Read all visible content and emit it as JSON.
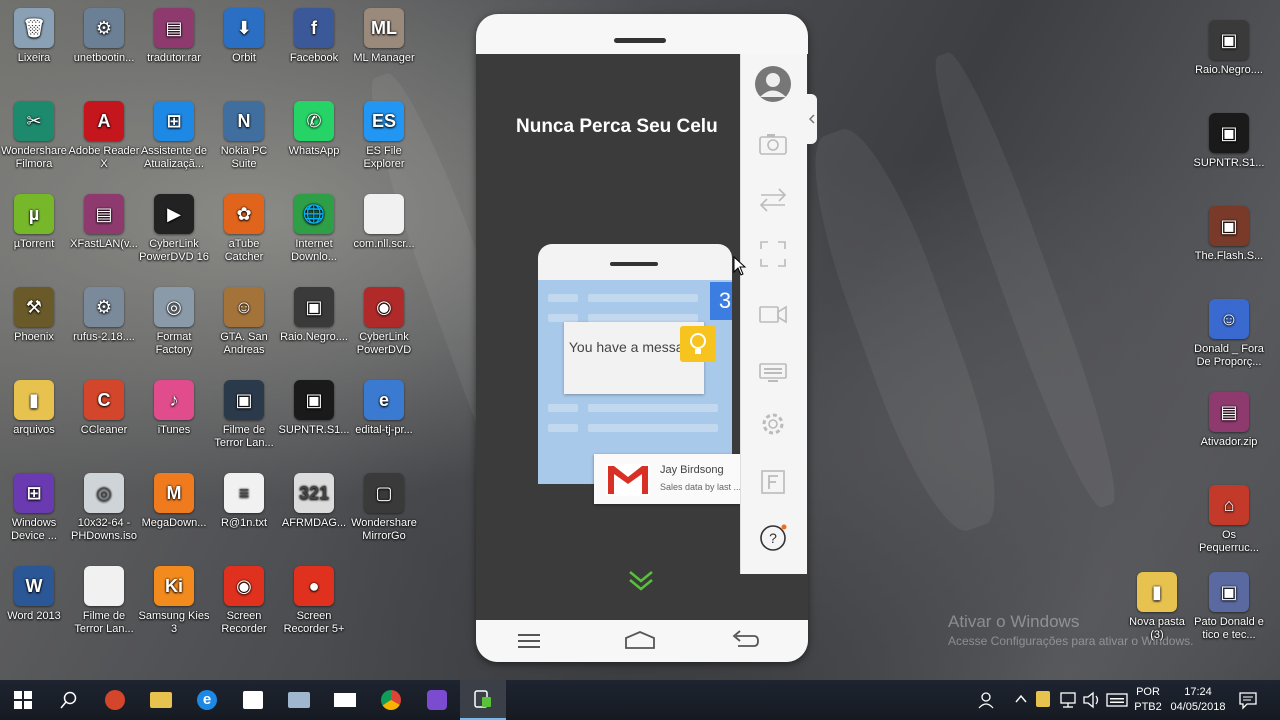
{
  "desktop": {
    "icons_left": [
      {
        "label": "Lixeira",
        "color": "#8aa0b4",
        "glyph": "🗑"
      },
      {
        "label": "unetbootin...",
        "color": "#6b7f95",
        "glyph": "⚙"
      },
      {
        "label": "tradutor.rar",
        "color": "#8e3a6e",
        "glyph": "▤"
      },
      {
        "label": "Orbit",
        "color": "#2a6fc4",
        "glyph": "⬇"
      },
      {
        "label": "Facebook",
        "color": "#3b5998",
        "glyph": "f"
      },
      {
        "label": "ML Manager",
        "color": "#9a8a7c",
        "glyph": "ML"
      },
      {
        "label": "Wondershare Filmora",
        "color": "#1d8a6e",
        "glyph": "✂"
      },
      {
        "label": "Adobe Reader X",
        "color": "#c4161c",
        "glyph": "A"
      },
      {
        "label": "Assistente de Atualizaçã...",
        "color": "#1e88e5",
        "glyph": "⊞"
      },
      {
        "label": "Nokia PC Suite",
        "color": "#3f6e9f",
        "glyph": "N"
      },
      {
        "label": "WhatsApp",
        "color": "#25d366",
        "glyph": "✆"
      },
      {
        "label": "ES File Explorer",
        "color": "#2196f3",
        "glyph": "ES"
      },
      {
        "label": "µTorrent",
        "color": "#76b82a",
        "glyph": "µ"
      },
      {
        "label": "XFastLAN(v...",
        "color": "#8e3a6e",
        "glyph": "▤"
      },
      {
        "label": "CyberLink PowerDVD 16",
        "color": "#222222",
        "glyph": "▶"
      },
      {
        "label": "aTube Catcher",
        "color": "#e0641c",
        "glyph": "✿"
      },
      {
        "label": "Internet Downlo...",
        "color": "#2e9e47",
        "glyph": "🌐"
      },
      {
        "label": "com.nll.scr...",
        "color": "#f1f1f1",
        "glyph": ""
      },
      {
        "label": "Phoenix",
        "color": "#6a5a2a",
        "glyph": "⚒"
      },
      {
        "label": "rufus-2.18....",
        "color": "#7a8a9a",
        "glyph": "⚙"
      },
      {
        "label": "Format Factory",
        "color": "#8b9aa8",
        "glyph": "◎"
      },
      {
        "label": "GTA. San Andreas",
        "color": "#a4733a",
        "glyph": "☺"
      },
      {
        "label": "Raio.Negro....",
        "color": "#3a3a3a",
        "glyph": "▣"
      },
      {
        "label": "CyberLink PowerDVD",
        "color": "#b02a2a",
        "glyph": "◉"
      },
      {
        "label": "arquivos",
        "color": "#e8c24f",
        "glyph": "▮"
      },
      {
        "label": "CCleaner",
        "color": "#d4462b",
        "glyph": "C"
      },
      {
        "label": "iTunes",
        "color": "#e04c8c",
        "glyph": "♪"
      },
      {
        "label": "Filme de Terror Lan...",
        "color": "#2a3a4a",
        "glyph": "▣"
      },
      {
        "label": "SUPNTR.S1...",
        "color": "#1a1a1a",
        "glyph": "▣"
      },
      {
        "label": "edital-tj-pr...",
        "color": "#3a7ad0",
        "glyph": "e"
      },
      {
        "label": "Windows Device ...",
        "color": "#6a3ab0",
        "glyph": "⊞"
      },
      {
        "label": "10x32-64 - PHDowns.iso",
        "color": "#cfd4d8",
        "glyph": "◎"
      },
      {
        "label": "MegaDown...",
        "color": "#f07b1e",
        "glyph": "M"
      },
      {
        "label": "R@1n.txt",
        "color": "#f1f1f1",
        "glyph": "≡"
      },
      {
        "label": "AFRMDAG...",
        "color": "#dcdcdc",
        "glyph": "321"
      },
      {
        "label": "Wondershare MirrorGo",
        "color": "#3a3a3a",
        "glyph": "▢"
      },
      {
        "label": "Word 2013",
        "color": "#2b5797",
        "glyph": "W"
      },
      {
        "label": "Filme de Terror Lan...",
        "color": "#f1f1f1",
        "glyph": ""
      },
      {
        "label": "Samsung Kies 3",
        "color": "#f28a1e",
        "glyph": "Ki"
      },
      {
        "label": "Screen Recorder",
        "color": "#e0311e",
        "glyph": "◉"
      },
      {
        "label": "Screen Recorder 5+",
        "color": "#e0311e",
        "glyph": "●"
      }
    ],
    "icons_right": [
      {
        "label": "Raio.Negro....",
        "color": "#3a3a3a",
        "glyph": "▣"
      },
      {
        "label": "SUPNTR.S1...",
        "color": "#1a1a1a",
        "glyph": "▣"
      },
      {
        "label": "The.Flash.S...",
        "color": "#7a3a2a",
        "glyph": "▣"
      },
      {
        "label": "Donald _ Fora De Proporç...",
        "color": "#3a6ad0",
        "glyph": "☺"
      },
      {
        "label": "Ativador.zip",
        "color": "#8e3a6e",
        "glyph": "▤"
      },
      {
        "label": "Os Pequerruc...",
        "color": "#c43a2a",
        "glyph": "⌂"
      },
      {
        "label": "Nova pasta (3)",
        "color": "#e8c24f",
        "glyph": "▮"
      },
      {
        "label": "Pato Donald e tico e tec...",
        "color": "#5a6aa0",
        "glyph": "▣"
      }
    ],
    "watermark_line1": "Ativar o Windows",
    "watermark_line2": "Acesse Configurações para ativar o Windows."
  },
  "phone": {
    "title": "Nunca Perca Seu Celu",
    "notification_text": "You have a message",
    "calendar_number": "3",
    "gmail_sender": "Jay Birdsong",
    "gmail_preview": "Sales data by last ..."
  },
  "taskbar": {
    "lang_top": "POR",
    "lang_bottom": "PTB2",
    "time": "17:24",
    "date": "04/05/2018"
  }
}
